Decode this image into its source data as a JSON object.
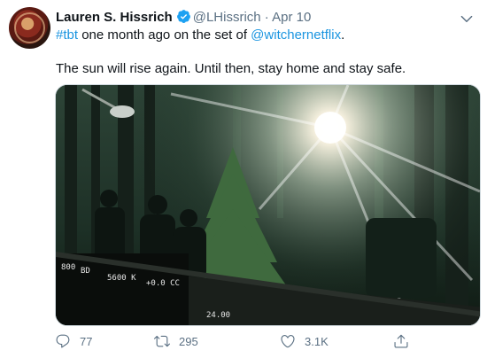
{
  "author": {
    "name": "Lauren S. Hissrich",
    "handle": "@LHissrich",
    "separator": "·",
    "date": "Apr 10"
  },
  "tweet": {
    "hashtag": "#tbt",
    "text_mid": " one month ago on the set of ",
    "mention": "@witchernetflix",
    "text_end": ".",
    "line2": "The sun will rise again. Until then, stay home and stay safe."
  },
  "media": {
    "camera_overlay": {
      "label_iso": "800",
      "label_fps": "BD",
      "label_kelvin": "5600 K",
      "label_cc": "+0.0 CC",
      "label_fps2": "24.00"
    }
  },
  "actions": {
    "replies": "77",
    "retweets": "295",
    "likes": "3.1K"
  },
  "colors": {
    "link": "#1b95e0",
    "verified": "#1da1f2",
    "muted": "#5b7083"
  },
  "icons": [
    "caret-down-icon",
    "verified-badge-icon",
    "reply-icon",
    "retweet-icon",
    "like-icon",
    "share-icon"
  ]
}
